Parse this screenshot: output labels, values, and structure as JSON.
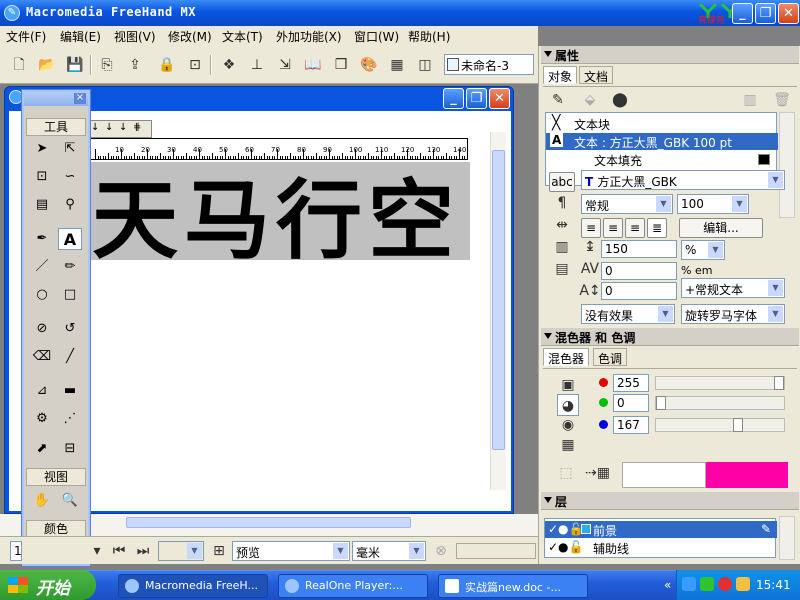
{
  "window": {
    "title": "Macromedia FreeHand MX",
    "logo_text": "育碟苑"
  },
  "menu": [
    "文件(F)",
    "编辑(E)",
    "视图(V)",
    "修改(M)",
    "文本(T)",
    "外加功能(X)",
    "窗口(W)",
    "帮助(H)"
  ],
  "toolbar": {
    "doc_selector": "未命名-3"
  },
  "canvas": {
    "text": "天马行空",
    "ruler_labels": [
      "10",
      "20",
      "30",
      "40",
      "50",
      "60",
      "70",
      "80",
      "90",
      "100",
      "110",
      "120",
      "130",
      "140"
    ]
  },
  "tools_panel": {
    "title": "工具",
    "view_section": "视图",
    "color_section": "颜色"
  },
  "statusbar": {
    "page": "1",
    "view_mode": "预览",
    "unit": "毫米"
  },
  "properties": {
    "title": "属性",
    "tabs": [
      "对象",
      "文档"
    ],
    "objects": [
      {
        "label": "文本块"
      },
      {
        "label": "文本 : 方正大黑_GBK 100 pt"
      },
      {
        "label": "文本填充"
      }
    ],
    "abc_label": "abc",
    "font": "方正大黑_GBK",
    "style": "常规",
    "size": "100",
    "edit_button": "编辑...",
    "leading": "150",
    "leading_unit": "%",
    "tracking": "0",
    "tracking_unit": "% em",
    "baseline": "0",
    "text_type": "+常规文本",
    "effect": "没有效果",
    "rotation": "旋转罗马字体"
  },
  "mixer": {
    "title": "混色器 和 色调",
    "tabs": [
      "混色器",
      "色调"
    ],
    "r": "255",
    "g": "0",
    "b": "167",
    "r_level": 1.0,
    "g_level": 0.0,
    "b_level": 0.655,
    "color": "#ff00a7"
  },
  "layers": {
    "title": "层",
    "items": [
      {
        "name": "前景",
        "color": "#22b0f0"
      },
      {
        "name": "辅助线",
        "color": "#ffffff"
      }
    ]
  },
  "taskbar": {
    "start": "开始",
    "tasks": [
      "Macromedia FreeH...",
      "RealOne Player:...",
      "实战篇new.doc -..."
    ],
    "clock": "15:41"
  }
}
